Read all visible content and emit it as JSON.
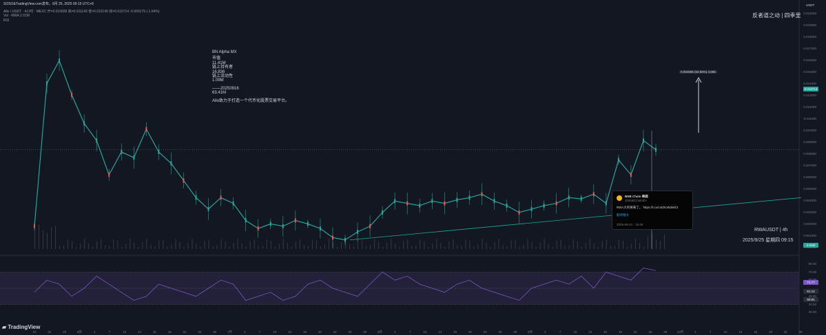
{
  "header": {
    "line1": "SOSO&TradingView.com发布，9月 25, 2025 09:15 UTC+8",
    "line2": "Allo / USDT · 4小时 · MEXC  开=0.010828  高=0.011149  低=0.010145  收=0.010714  -0.000179 (-1.64%)",
    "line3": "Vol · RWA  2.01M",
    "line4": "RSI"
  },
  "watermark": "反者道之动 | 四季里",
  "currency_label": "USDT",
  "note": {
    "title": "BN Alpha MX",
    "lines": [
      "市值",
      "11.41M",
      "链上持有者",
      "16,836",
      "链上流动性",
      "1.09M",
      "",
      "——20250916",
      "63.41M",
      "",
      "Allo致力于打造一个代币化股票交易平台。"
    ]
  },
  "measure_label": "0.004595 (63.58%) 4,595",
  "tweet": {
    "name": "BNB Chain 華語",
    "handle": "@BNBChainZH",
    "text": "RWA大的要来了。 https://t.co/U4ZKXkdWZ3",
    "translate": "翻译推文",
    "time": "2025-09-24 · 19:48"
  },
  "symbol_info": {
    "line1": "RWAUSDT | 4h",
    "line2": "2025/9/25 星期四 09:15"
  },
  "price_scale": {
    "ticks": [
      "0.022000",
      "0.019000",
      "0.018000",
      "0.017000",
      "0.016000",
      "0.015000",
      "0.014000",
      "0.013000",
      "0.012000",
      "0.011000",
      "0.010000",
      "0.009000",
      "0.008000",
      "0.007000",
      "0.006000",
      "0.005000",
      "0.004000",
      "0.003000",
      "0.002000",
      "0.001000",
      "0.000000"
    ],
    "current_price": "0.010714",
    "current_color": "#26a69a",
    "vol_badge": "2.01M"
  },
  "rsi_scale": {
    "ticks": [
      "80.00",
      "70.00",
      "60.00",
      "40.00",
      "30.00",
      "20.00"
    ],
    "rsi_badges": [
      "71.77",
      "61.12",
      "50.81"
    ]
  },
  "xaxis": [
    "22",
    "26",
    "29",
    "6月",
    "4",
    "7",
    "10",
    "13",
    "16",
    "19",
    "22",
    "25",
    "28",
    "7月",
    "4",
    "7",
    "10",
    "13",
    "16",
    "19",
    "22",
    "25",
    "28",
    "8月",
    "4",
    "7",
    "10",
    "13",
    "16",
    "19",
    "22",
    "25",
    "28",
    "9月",
    "4",
    "7",
    "10",
    "13",
    "16",
    "19",
    "22",
    "25",
    "28",
    "10月",
    "4",
    "7",
    "10",
    "13",
    "16",
    "19",
    "22",
    "25"
  ],
  "footer": "TradingView",
  "chart_data": {
    "type": "line",
    "title": "Allo / USDT · 4小时 · MEXC",
    "xlabel": "",
    "ylabel": "",
    "series": [
      {
        "values": [
          0.004,
          0.0165,
          0.0185,
          0.0155,
          0.013,
          0.0115,
          0.0085,
          0.0105,
          0.01,
          0.0125,
          0.0105,
          0.0095,
          0.008,
          0.0065,
          0.0055,
          0.0065,
          0.006,
          0.0045,
          0.0038,
          0.0042,
          0.004,
          0.0045,
          0.0042,
          0.0038,
          0.003,
          0.0028,
          0.0035,
          0.004,
          0.0052,
          0.0062,
          0.006,
          0.0058,
          0.0062,
          0.006,
          0.0063,
          0.0065,
          0.0068,
          0.0062,
          0.0058,
          0.0052,
          0.0055,
          0.0058,
          0.006,
          0.0065,
          0.0064,
          0.0068,
          0.006,
          0.0098,
          0.0085,
          0.0115,
          0.0107
        ]
      }
    ],
    "ylim": [
      0.002,
      0.022
    ],
    "color": "#26a69a",
    "rsi": [
      45,
      60,
      55,
      40,
      50,
      65,
      55,
      45,
      35,
      40,
      55,
      50,
      45,
      40,
      50,
      60,
      55,
      35,
      40,
      45,
      35,
      40,
      55,
      60,
      50,
      45,
      40,
      55,
      70,
      60,
      65,
      55,
      50,
      45,
      55,
      60,
      50,
      45,
      40,
      35,
      50,
      55,
      60,
      55,
      65,
      50,
      70,
      65,
      60,
      75,
      71.77
    ],
    "rsi_color": "#7e57c2"
  }
}
